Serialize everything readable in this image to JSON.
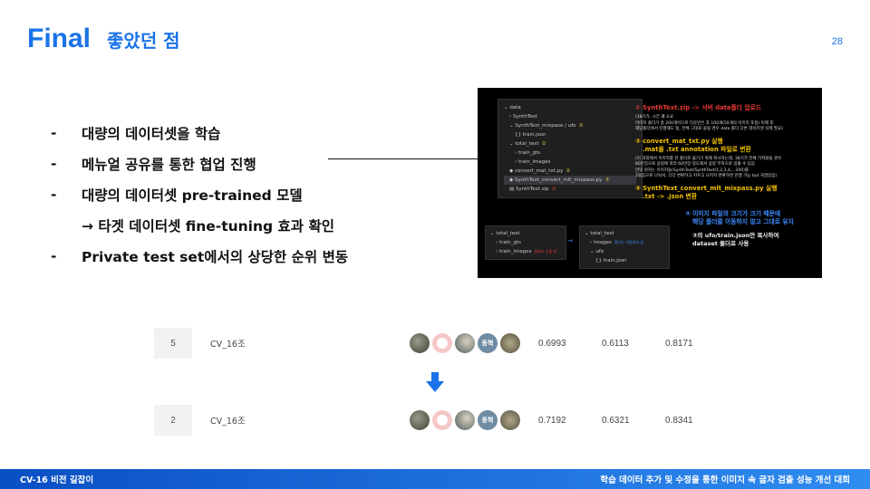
{
  "header": {
    "title": "Final",
    "subtitle": "좋았던 점",
    "page_number": "28"
  },
  "bullets": [
    {
      "dash": "-",
      "text": "대량의 데이터셋을 학습"
    },
    {
      "dash": "-",
      "text": "메뉴얼 공유를 통한 협업 진행"
    },
    {
      "dash": "-",
      "text": "대량의 데이터셋 pre-trained 모델"
    },
    {
      "dash": "",
      "text": "→ 타겟 데이터셋 fine-tuning 효과 확인"
    },
    {
      "dash": "-",
      "text": "Private test set에서의 상당한 순위 변동"
    }
  ],
  "screenshot": {
    "tree": [
      "data",
      "SynthText",
      "SynthText_mixpase / ufo",
      "train.json",
      "total_text",
      "train_gts",
      "train_images",
      "convert_mat_txt.py",
      "SynthText_convert_mlt_mixpass.py",
      "SynthText.zip"
    ],
    "markers": {
      "m1": "①",
      "m2": "②",
      "m3": "③",
      "m4": "④"
    },
    "notes": {
      "n1_title": "① SynthText.zip -> 서버 data폴더 업로드",
      "n1_body1": "(38기가, 시간 꽤 소요",
      "n1_body2": "이미지 폴더가 총 200개이므로 다운받은 후 100개(50개의 이미지 포함) 이제 후",
      "n1_body3": "해당폴더에서 진행해도 됨, 전체 그대로 올릴 경우 data 폴더 다른 데이터셋 삭제 필요)",
      "n2_title": "② convert_mat_txt.py 실행",
      "n2_sub": ".mat을 .txt annotation 파일로 변환",
      "n2_body1": "(이 과정에서 이미지를 한 폴더로 옮기기 위해 복사하는데, 38기가 전체 가져왔을 경우",
      "n2_body2": "80만장으로 용량에 따라 60만장 정도에서 용량 부족으로 멈출 수 있음",
      "n2_body3": "만약 원하는 이미지들(SynthText/SynthText/1,2,3,4,...200)를",
      "n2_body4": "2묶음으로 나눠서, 각각 변환하고 지우고 나머지 변환하면 진행 가능 but 귀찮았음)",
      "n3_title": "③ SynthText_convert_mlt_mixpass.py 실행",
      "n3_sub": ".txt -> .json 변환",
      "n4_title1": "④ 이미지 파일의 크기가 크기 때문에",
      "n4_title2": "해당 폴더를 이동하지 않고 그대로 유지",
      "n5_title1": "③의 ufo/train.json만 복사하여",
      "n5_title2": "dataset 폴더로 사용"
    },
    "tree2": [
      "total_text",
      "train_gts",
      "train_images"
    ],
    "tree2_tag": "클래스 추출 데",
    "tree3": [
      "total_text",
      "images",
      "ufo",
      "train.json"
    ],
    "tree3_tag": "폴더는 이동하지 않",
    "arrow": "→"
  },
  "leaderboard": {
    "before": {
      "rank": "5",
      "team": "CV_16조",
      "avatar_label": "동혁",
      "scores": [
        "0.6993",
        "0.6113",
        "0.8171"
      ]
    },
    "after": {
      "rank": "2",
      "team": "CV_16조",
      "avatar_label": "동혁",
      "scores": [
        "0.7192",
        "0.6321",
        "0.8341"
      ]
    }
  },
  "colors": {
    "accent": "#1a73e8",
    "arrow": "#1a73e8"
  },
  "footer": {
    "left": "CV-16 비전 길잡이",
    "right": "학습 데이터 추가 및 수정을 통한 이미지 속 글자 검출 성능 개선 대회"
  }
}
